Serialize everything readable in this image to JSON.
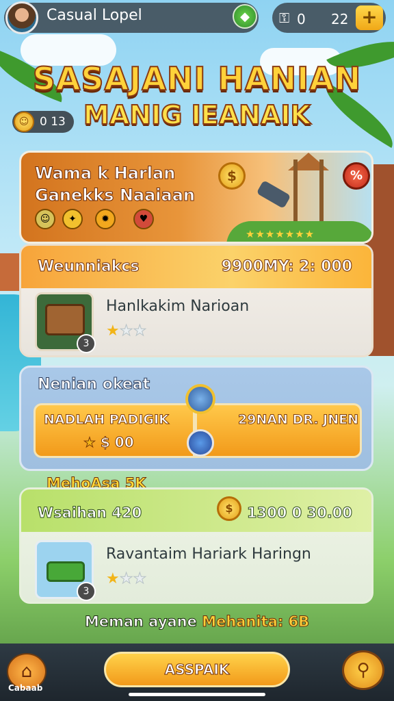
{
  "header": {
    "player_name": "Casual Lopel",
    "currency_a": "0",
    "currency_b": "22",
    "plus_label": "+"
  },
  "title": {
    "line1": "SASAJANI HANIAN",
    "line2": "MANIG IEANAIK"
  },
  "coin_counter": "0 13",
  "banner": {
    "line1": "Wama k Harlan",
    "line2": "Ganekks Naaiaan",
    "coin_symbol": "$",
    "badge_symbol": "%",
    "stars": "★★★★★★★"
  },
  "section1": {
    "label": "Weunniakcs",
    "value": "9900MY: 2: 000",
    "item": {
      "name": "Hanlkakim Narioan",
      "level": "3",
      "stars_filled": 1,
      "stars_total": 3
    }
  },
  "section2": {
    "label": "Nenian okeat",
    "deal_left_title": "NADLAH PADIGIK",
    "deal_left_sub": "$ 00",
    "deal_right_title": "29NAN DR. JNEN"
  },
  "section3": {
    "heading": "MehoAsa 5K",
    "label": "Wsaihan 420",
    "coin_symbol": "$",
    "value": "1300 0 30.00",
    "item": {
      "name": "Ravantaim Hariark Haringn",
      "level": "3",
      "stars_filled": 1,
      "stars_total": 3
    }
  },
  "bonus": {
    "text": "Meman ayane",
    "highlight": "Mehanita: 6B"
  },
  "bottom_nav": {
    "home_label": "Cabaab",
    "main_button": "ASSPAIK"
  },
  "colors": {
    "accent_orange": "#f29a1a",
    "title_yellow": "#ffd23a",
    "panel_green": "#b8e06a",
    "panel_blue": "#a9c8e8"
  },
  "icons": [
    "avatar",
    "gem-icon",
    "key-icon",
    "plus-icon",
    "coin-icon",
    "medal-icon",
    "chest-icon",
    "star-icon",
    "home-icon",
    "search-icon"
  ]
}
